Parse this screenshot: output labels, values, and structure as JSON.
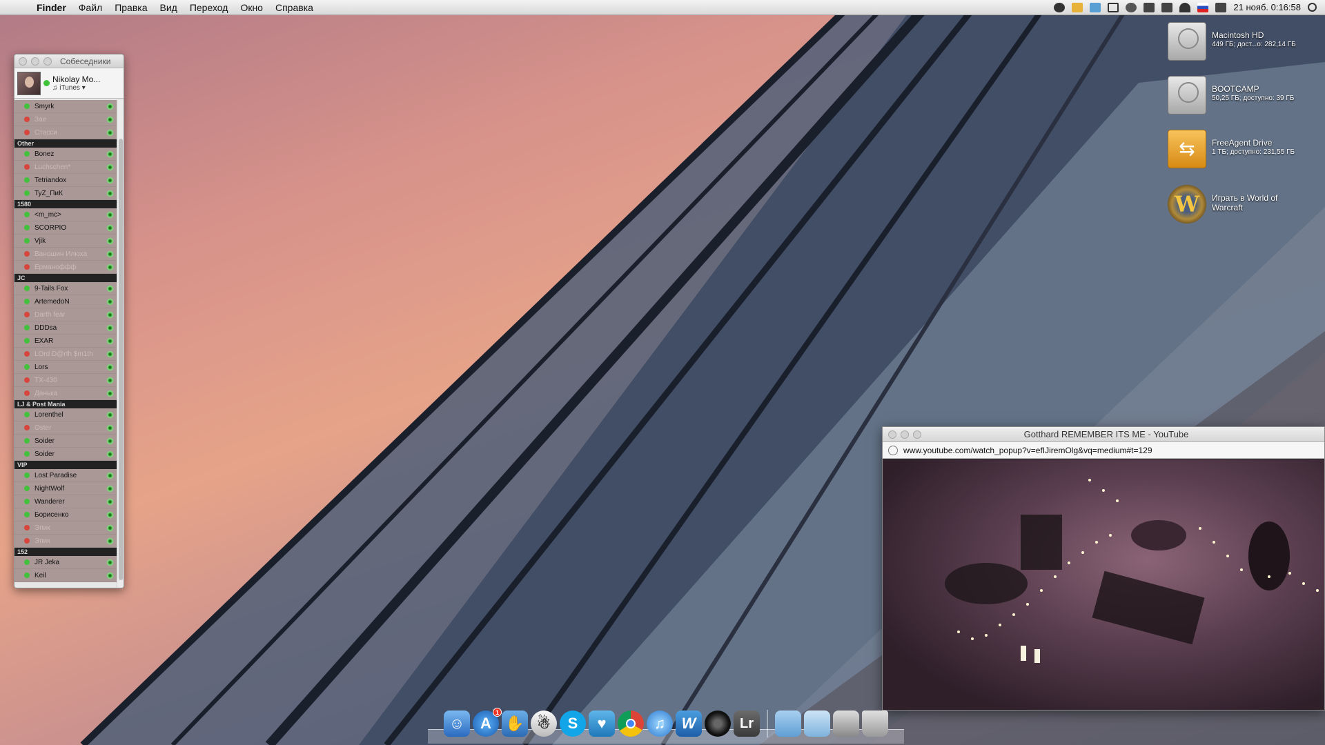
{
  "menubar": {
    "app": "Finder",
    "items": [
      "Файл",
      "Правка",
      "Вид",
      "Переход",
      "Окно",
      "Справка"
    ],
    "clock": "21 нояб. 0:16:58"
  },
  "contacts_window": {
    "title": "Собеседники",
    "profile": {
      "name": "Nikolay Mo...",
      "status": "♫ iTunes ▾"
    },
    "groups": [
      {
        "name": "",
        "contacts": [
          {
            "name": "Smyrk",
            "online": true
          },
          {
            "name": "Зае",
            "online": false
          },
          {
            "name": "Стасси",
            "online": false
          }
        ]
      },
      {
        "name": "Other",
        "contacts": [
          {
            "name": "Bonez",
            "online": true
          },
          {
            "name": "Luchschen*",
            "online": false
          },
          {
            "name": "Tetriandox",
            "online": true
          },
          {
            "name": "TyZ_ПиК",
            "online": true
          }
        ]
      },
      {
        "name": "1580",
        "contacts": [
          {
            "name": "<m_mc>",
            "online": true
          },
          {
            "name": "SCORPIO",
            "online": true
          },
          {
            "name": "Vjik",
            "online": true
          },
          {
            "name": "Ваношин Илюха",
            "online": false
          },
          {
            "name": "Ерманоффф",
            "online": false
          }
        ]
      },
      {
        "name": "JC",
        "contacts": [
          {
            "name": "9-Tails Fox",
            "online": true
          },
          {
            "name": "ArtemedoN",
            "online": true
          },
          {
            "name": "Darth fear",
            "online": false
          },
          {
            "name": "DDDsa",
            "online": true
          },
          {
            "name": "EXAR",
            "online": true
          },
          {
            "name": "LOrd D@rth $m1th",
            "online": false
          },
          {
            "name": "Lors",
            "online": true
          },
          {
            "name": "TX-430",
            "online": false
          },
          {
            "name": "Данька",
            "online": false
          }
        ]
      },
      {
        "name": "LJ & Post Mania",
        "contacts": [
          {
            "name": "Lorenthel",
            "online": true
          },
          {
            "name": "Oster",
            "online": false
          },
          {
            "name": "Soider",
            "online": true
          },
          {
            "name": "Soider",
            "online": true
          }
        ]
      },
      {
        "name": "VIP",
        "contacts": [
          {
            "name": "Lost Paradise",
            "online": true
          },
          {
            "name": "NightWolf",
            "online": true
          },
          {
            "name": "Wanderer",
            "online": true
          },
          {
            "name": "Борисенко",
            "online": true
          },
          {
            "name": "Эпик",
            "online": false
          },
          {
            "name": "Эпик",
            "online": false
          }
        ]
      },
      {
        "name": "152",
        "contacts": [
          {
            "name": "JR Jeka",
            "online": true
          },
          {
            "name": "Keil",
            "online": true
          }
        ]
      }
    ]
  },
  "desktop_icons": [
    {
      "name": "Macintosh HD",
      "sub": "449 ГБ; дост...о: 282,14 ГБ",
      "icon": "hdd-icon"
    },
    {
      "name": "BOOTCAMP",
      "sub": "50,25 ГБ; доступно: 39 ГБ",
      "icon": "hdd-icon"
    },
    {
      "name": "FreeAgent Drive",
      "sub": "1 ТБ; доступно: 231,55 ГБ",
      "icon": "usb-drive-icon"
    },
    {
      "name": "Играть в World of",
      "sub": "Warcraft",
      "icon": "wow-icon"
    }
  ],
  "youtube_window": {
    "title": "Gotthard REMEMBER ITS ME - YouTube",
    "url": "www.youtube.com/watch_popup?v=efIJiremOlg&vq=medium#t=129"
  },
  "dock": {
    "items": [
      "finder-icon",
      "app-store-icon",
      "growl-icon",
      "adium-icon",
      "skype-icon",
      "twitter-icon",
      "chrome-icon",
      "itunes-icon",
      "word-icon",
      "camera-icon",
      "lightroom-icon"
    ],
    "app_store_badge": "1",
    "lightroom_label": "Lr",
    "word_label": "W",
    "skype_label": "S",
    "apple_glyph": ""
  }
}
